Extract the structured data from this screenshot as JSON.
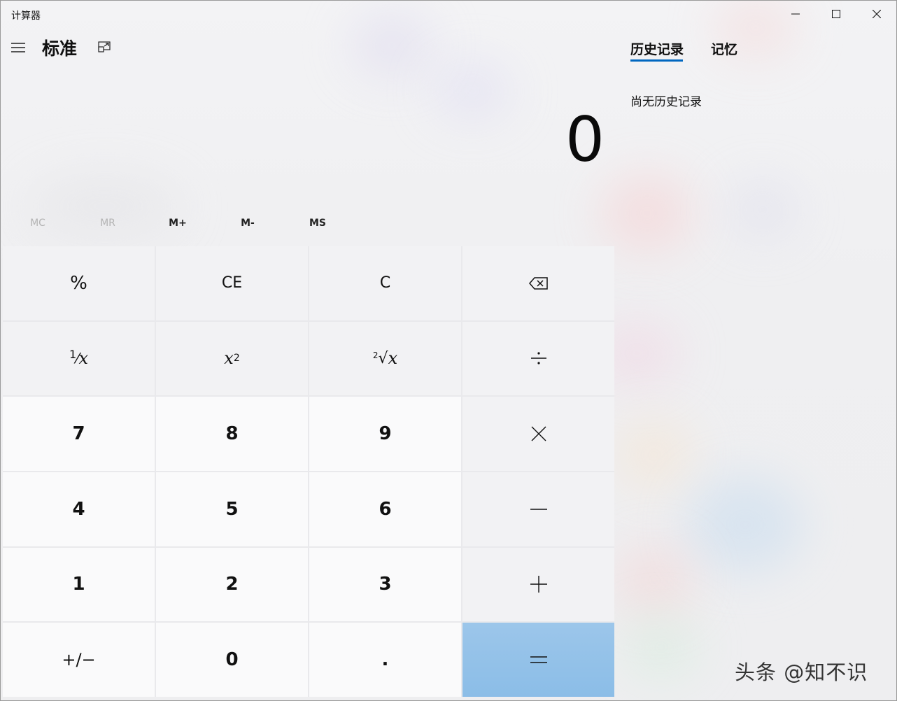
{
  "window": {
    "title": "计算器",
    "controls": [
      "minimize",
      "maximize",
      "close"
    ]
  },
  "header": {
    "mode_title": "标准"
  },
  "display": {
    "value": "0"
  },
  "memory": {
    "buttons": [
      "MC",
      "MR",
      "M+",
      "M-",
      "MS"
    ],
    "disabled": [
      "MC",
      "MR"
    ]
  },
  "keypad": {
    "percent": "%",
    "ce": "CE",
    "c": "C",
    "backspace_icon": "backspace-icon",
    "reciprocal": "x",
    "reciprocal_numer": "1",
    "square": "x",
    "square_exp": "2",
    "sqrt_index": "2",
    "sqrt_sign": "√",
    "sqrt_var": "x",
    "divide_icon": "divide-icon",
    "multiply_icon": "multiply-icon",
    "minus_icon": "minus-icon",
    "plus_icon": "plus-icon",
    "equals_icon": "equals-icon",
    "digits": [
      "7",
      "8",
      "9",
      "4",
      "5",
      "6",
      "1",
      "2",
      "3",
      "0"
    ],
    "negate": "+/−",
    "decimal": "."
  },
  "side_panel": {
    "tabs": [
      "历史记录",
      "记忆"
    ],
    "active_tab": "历史记录",
    "empty_message": "尚无历史记录"
  },
  "watermark": "头条 @知不识",
  "colors": {
    "accent": "#0067c0",
    "equals_bg": "#8bbde7",
    "digit_bg": "#fafafb",
    "operator_bg": "#f2f2f4"
  }
}
